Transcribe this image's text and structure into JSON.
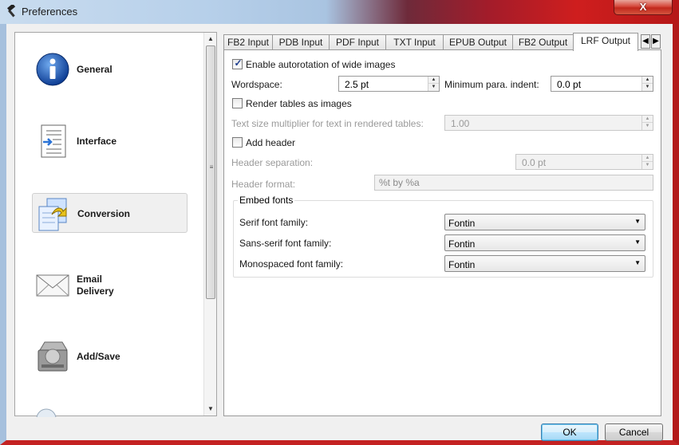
{
  "window": {
    "title": "Preferences",
    "close_glyph": "X"
  },
  "sidebar": {
    "items": [
      {
        "label": "General",
        "icon": "info-icon"
      },
      {
        "label": "Interface",
        "icon": "document-arrow-icon"
      },
      {
        "label": "Conversion",
        "icon": "conversion-icon",
        "selected": true
      },
      {
        "label1": "Email",
        "label2": "Delivery",
        "icon": "envelope-icon"
      },
      {
        "label": "Add/Save",
        "icon": "hard-drive-icon"
      }
    ]
  },
  "tabs": [
    "FB2 Input",
    "PDB Input",
    "PDF Input",
    "TXT Input",
    "EPUB Output",
    "FB2 Output",
    "LRF Output"
  ],
  "active_tab": "LRF Output",
  "lrf": {
    "autorotation_label": "Enable autorotation of wide images",
    "autorotation_checked": true,
    "wordspace_label": "Wordspace:",
    "wordspace_value": "2.5 pt",
    "min_indent_label": "Minimum para. indent:",
    "min_indent_value": "0.0 pt",
    "render_tables_label": "Render tables as images",
    "render_tables_checked": false,
    "text_size_label": "Text size multiplier for text in rendered tables:",
    "text_size_value": "1.00",
    "add_header_label": "Add header",
    "add_header_checked": false,
    "header_sep_label": "Header separation:",
    "header_sep_value": "0.0 pt",
    "header_format_label": "Header format:",
    "header_format_value": "%t by %a"
  },
  "embed_fonts": {
    "title": "Embed fonts",
    "serif_label": "Serif font family:",
    "serif_value": "Fontin",
    "sans_label": "Sans-serif font family:",
    "sans_value": "Fontin",
    "mono_label": "Monospaced font family:",
    "mono_value": "Fontin"
  },
  "buttons": {
    "ok": "OK",
    "cancel": "Cancel"
  },
  "colors": {
    "accent": "#3c7fb1",
    "title_red": "#c42222"
  }
}
